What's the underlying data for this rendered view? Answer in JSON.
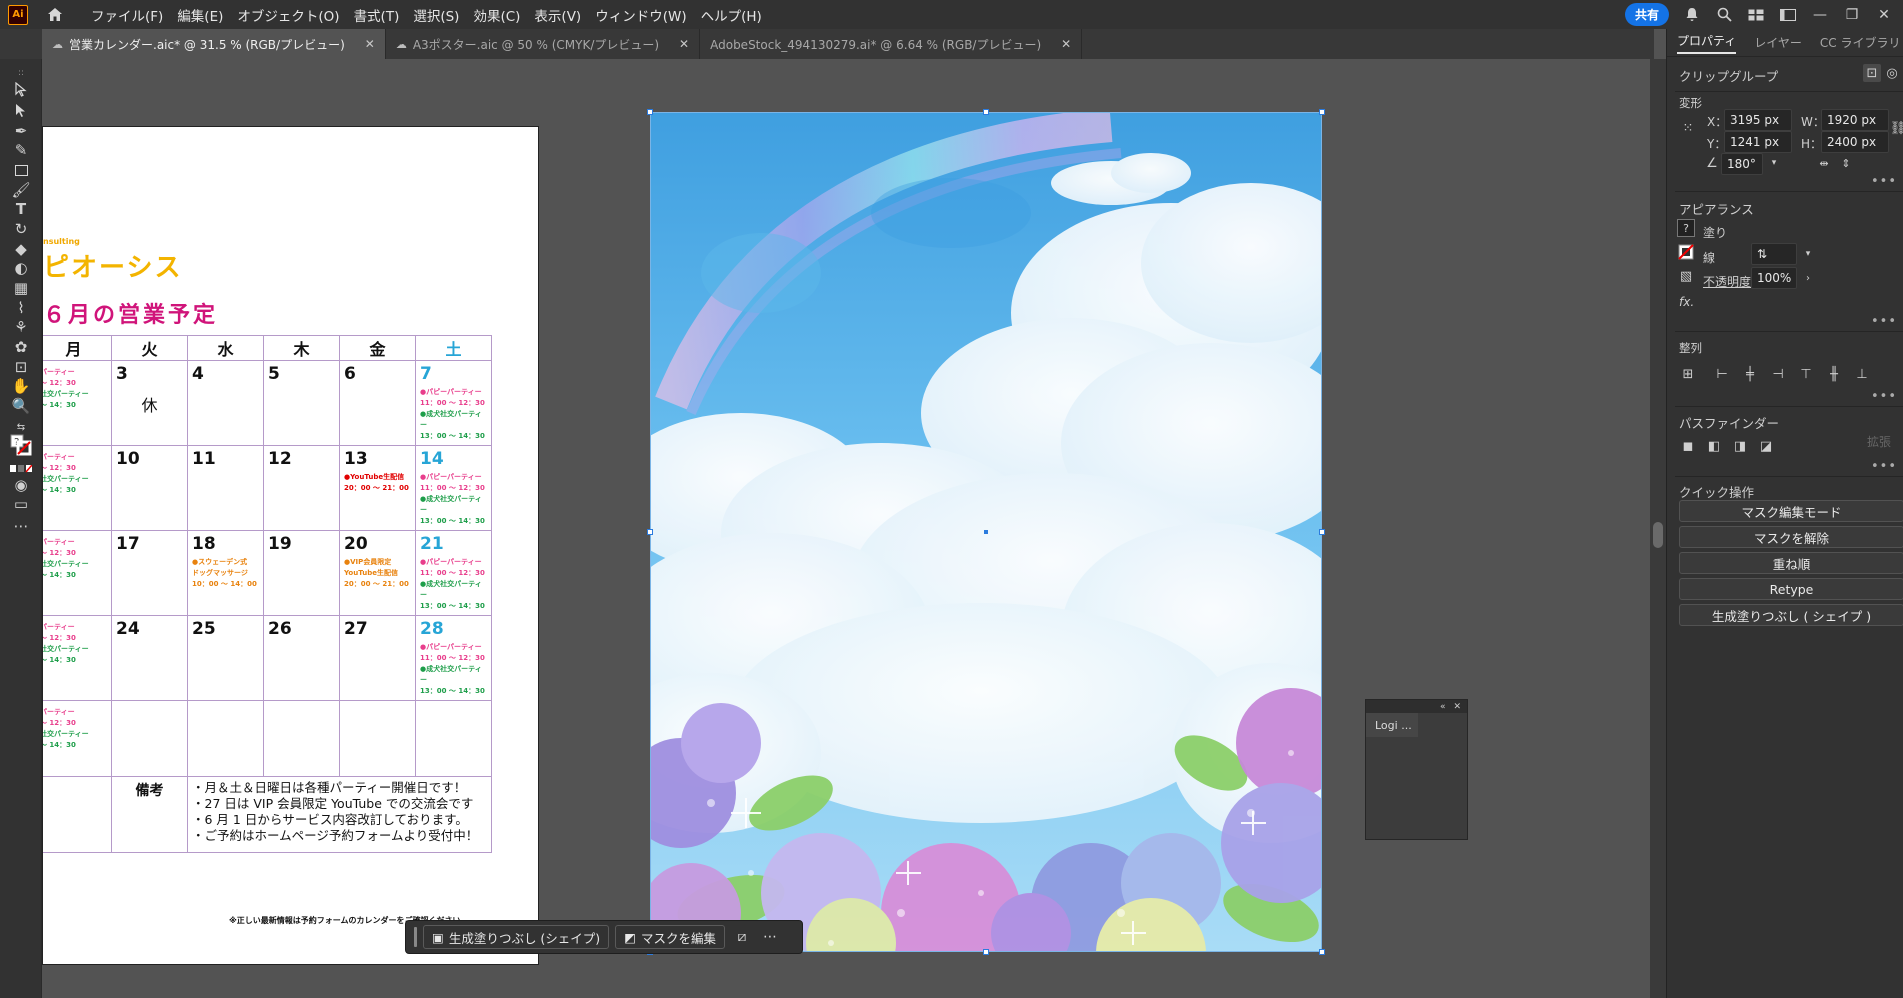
{
  "app": {
    "logo_text": "Ai",
    "menu": [
      "ファイル(F)",
      "編集(E)",
      "オブジェクト(O)",
      "書式(T)",
      "選択(S)",
      "効果(C)",
      "表示(V)",
      "ウィンドウ(W)",
      "ヘルプ(H)"
    ],
    "share_label": "共有"
  },
  "tabs": [
    {
      "label": "営業カレンダー.aic* @ 31.5 % (RGB/プレビュー)",
      "active": true
    },
    {
      "label": "A3ポスター.aic @ 50 % (CMYK/プレビュー)",
      "active": false
    },
    {
      "label": "AdobeStock_494130279.ai* @ 6.64 % (RGB/プレビュー)",
      "active": false
    }
  ],
  "calendar": {
    "small_text": "nsulting",
    "company": "ピオーシス",
    "heading": "６月の営業予定",
    "headers": [
      "月",
      "火",
      "水",
      "木",
      "金",
      "土"
    ],
    "rows": [
      {
        "cells": [
          {
            "day": "",
            "events": [
              {
                "t": "パーティー",
                "c": "pink"
              },
              {
                "t": "～ 12：30",
                "c": "pink"
              },
              {
                "t": "社交パーティー",
                "c": "green"
              },
              {
                "t": "～ 14：30",
                "c": "green"
              }
            ]
          },
          {
            "day": "3",
            "holiday": "休"
          },
          {
            "day": "4"
          },
          {
            "day": "5"
          },
          {
            "day": "6"
          },
          {
            "day": "7",
            "sat": true,
            "events": [
              {
                "t": "●パピーパーティー",
                "c": "pink"
              },
              {
                "t": "11：00 ～ 12：30",
                "c": "pink"
              },
              {
                "t": "●成犬社交パーティー",
                "c": "green"
              },
              {
                "t": "13：00 ～ 14：30",
                "c": "green"
              }
            ]
          }
        ]
      },
      {
        "cells": [
          {
            "day": "",
            "events": [
              {
                "t": "パーティー",
                "c": "pink"
              },
              {
                "t": "～ 12：30",
                "c": "pink"
              },
              {
                "t": "社交パーティー",
                "c": "green"
              },
              {
                "t": "～ 14：30",
                "c": "green"
              }
            ]
          },
          {
            "day": "10"
          },
          {
            "day": "11"
          },
          {
            "day": "12"
          },
          {
            "day": "13",
            "events": [
              {
                "t": "●YouTube生配信",
                "c": "red"
              },
              {
                "t": "20：00 ～ 21：00",
                "c": "red"
              }
            ]
          },
          {
            "day": "14",
            "sat": true,
            "events": [
              {
                "t": "●パピーパーティー",
                "c": "pink"
              },
              {
                "t": "11：00 ～ 12：30",
                "c": "pink"
              },
              {
                "t": "●成犬社交パーティー",
                "c": "green"
              },
              {
                "t": "13：00 ～ 14：30",
                "c": "green"
              }
            ]
          }
        ]
      },
      {
        "cells": [
          {
            "day": "",
            "events": [
              {
                "t": "パーティー",
                "c": "pink"
              },
              {
                "t": "～ 12：30",
                "c": "pink"
              },
              {
                "t": "社交パーティー",
                "c": "green"
              },
              {
                "t": "～ 14：30",
                "c": "green"
              }
            ]
          },
          {
            "day": "17"
          },
          {
            "day": "18",
            "events": [
              {
                "t": "●スウェーデン式",
                "c": "orange"
              },
              {
                "t": "ドッグマッサージ",
                "c": "orange"
              },
              {
                "t": "10：00 ～ 14：00",
                "c": "orange"
              }
            ]
          },
          {
            "day": "19"
          },
          {
            "day": "20",
            "events": [
              {
                "t": "●VIP会員限定",
                "c": "orange"
              },
              {
                "t": "YouTube生配信",
                "c": "orange"
              },
              {
                "t": "20：00 ～ 21：00",
                "c": "orange"
              }
            ]
          },
          {
            "day": "21",
            "sat": true,
            "events": [
              {
                "t": "●パピーパーティー",
                "c": "pink"
              },
              {
                "t": "11：00 ～ 12：30",
                "c": "pink"
              },
              {
                "t": "●成犬社交パーティー",
                "c": "green"
              },
              {
                "t": "13：00 ～ 14：30",
                "c": "green"
              }
            ]
          }
        ]
      },
      {
        "cells": [
          {
            "day": "",
            "events": [
              {
                "t": "パーティー",
                "c": "pink"
              },
              {
                "t": "～ 12：30",
                "c": "pink"
              },
              {
                "t": "社交パーティー",
                "c": "green"
              },
              {
                "t": "～ 14：30",
                "c": "green"
              }
            ]
          },
          {
            "day": "24"
          },
          {
            "day": "25"
          },
          {
            "day": "26"
          },
          {
            "day": "27"
          },
          {
            "day": "28",
            "sat": true,
            "events": [
              {
                "t": "●パピーパーティー",
                "c": "pink"
              },
              {
                "t": "11：00 ～ 12：30",
                "c": "pink"
              },
              {
                "t": "●成犬社交パーティー",
                "c": "green"
              },
              {
                "t": "13：00 ～ 14：30",
                "c": "green"
              }
            ]
          }
        ]
      },
      {
        "cells": [
          {
            "day": "",
            "events": [
              {
                "t": "パーティー",
                "c": "pink"
              },
              {
                "t": "～ 12：30",
                "c": "pink"
              },
              {
                "t": "社交パーティー",
                "c": "green"
              },
              {
                "t": "～ 14：30",
                "c": "green"
              }
            ]
          },
          {
            "day": ""
          },
          {
            "day": ""
          },
          {
            "day": ""
          },
          {
            "day": ""
          },
          {
            "day": ""
          }
        ]
      }
    ],
    "notes_label": "備考",
    "notes": [
      "・月＆土＆日曜日は各種パーティー開催日です！",
      "・27 日は VIP 会員限定 YouTube での交流会です",
      "・6 月 1 日からサービス内容改訂しております。",
      "・ご予約はホームページ予約フォームより受付中！"
    ],
    "footnote": "※正しい最新情報は予約フォームのカレンダーをご確認ください"
  },
  "context_bar": {
    "gen_fill_label": "生成塗りつぶし (シェイプ)",
    "edit_mask_label": "マスクを編集"
  },
  "logi_panel": {
    "tab": "Logi ..."
  },
  "right_panel": {
    "tabs": [
      "プロパティ",
      "レイヤー",
      "CC ライブラリ"
    ],
    "object_type": "クリップグループ",
    "transform": {
      "title": "変形",
      "x_label": "X：",
      "x": "3195 px",
      "y_label": "Y：",
      "y": "1241 px",
      "w_label": "W：",
      "w": "1920 px",
      "h_label": "H：",
      "h": "2400 px",
      "angle": "180°"
    },
    "appearance": {
      "title": "アピアランス",
      "fill_label": "塗り",
      "stroke_label": "線",
      "opacity_label": "不透明度",
      "opacity": "100%",
      "fx": "fx."
    },
    "align_title": "整列",
    "pathfinder": {
      "title": "パスファインダー",
      "expand": "拡張"
    },
    "quick_actions": {
      "title": "クイック操作",
      "buttons": [
        "マスク編集モード",
        "マスクを解除",
        "重ね順",
        "Retype",
        "生成塗りつぶし ( シェイプ )"
      ]
    }
  },
  "colors": {
    "accent": "#1473e6",
    "canvas": "#535353",
    "panel": "#323232"
  }
}
